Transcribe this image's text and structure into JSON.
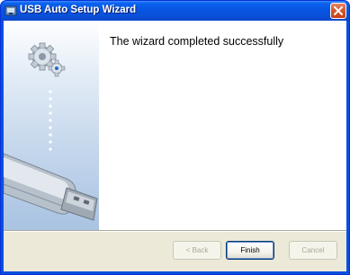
{
  "window": {
    "title": "USB Auto Setup Wizard",
    "app_icon": "usb-setup-app-icon",
    "close_icon": "close-icon"
  },
  "side_panel": {
    "gears_icon": "gears-icon",
    "usb_icon": "usb-drive-icon"
  },
  "content": {
    "heading": "The wizard completed successfully"
  },
  "buttons": {
    "back_label": "< Back",
    "finish_label": "Finish",
    "cancel_label": "Cancel",
    "back_enabled": false,
    "finish_enabled": true,
    "cancel_enabled": false
  },
  "colors": {
    "titlebar": "#0854e0",
    "dialog_face": "#ece9d8",
    "close_button": "#d8572b"
  }
}
